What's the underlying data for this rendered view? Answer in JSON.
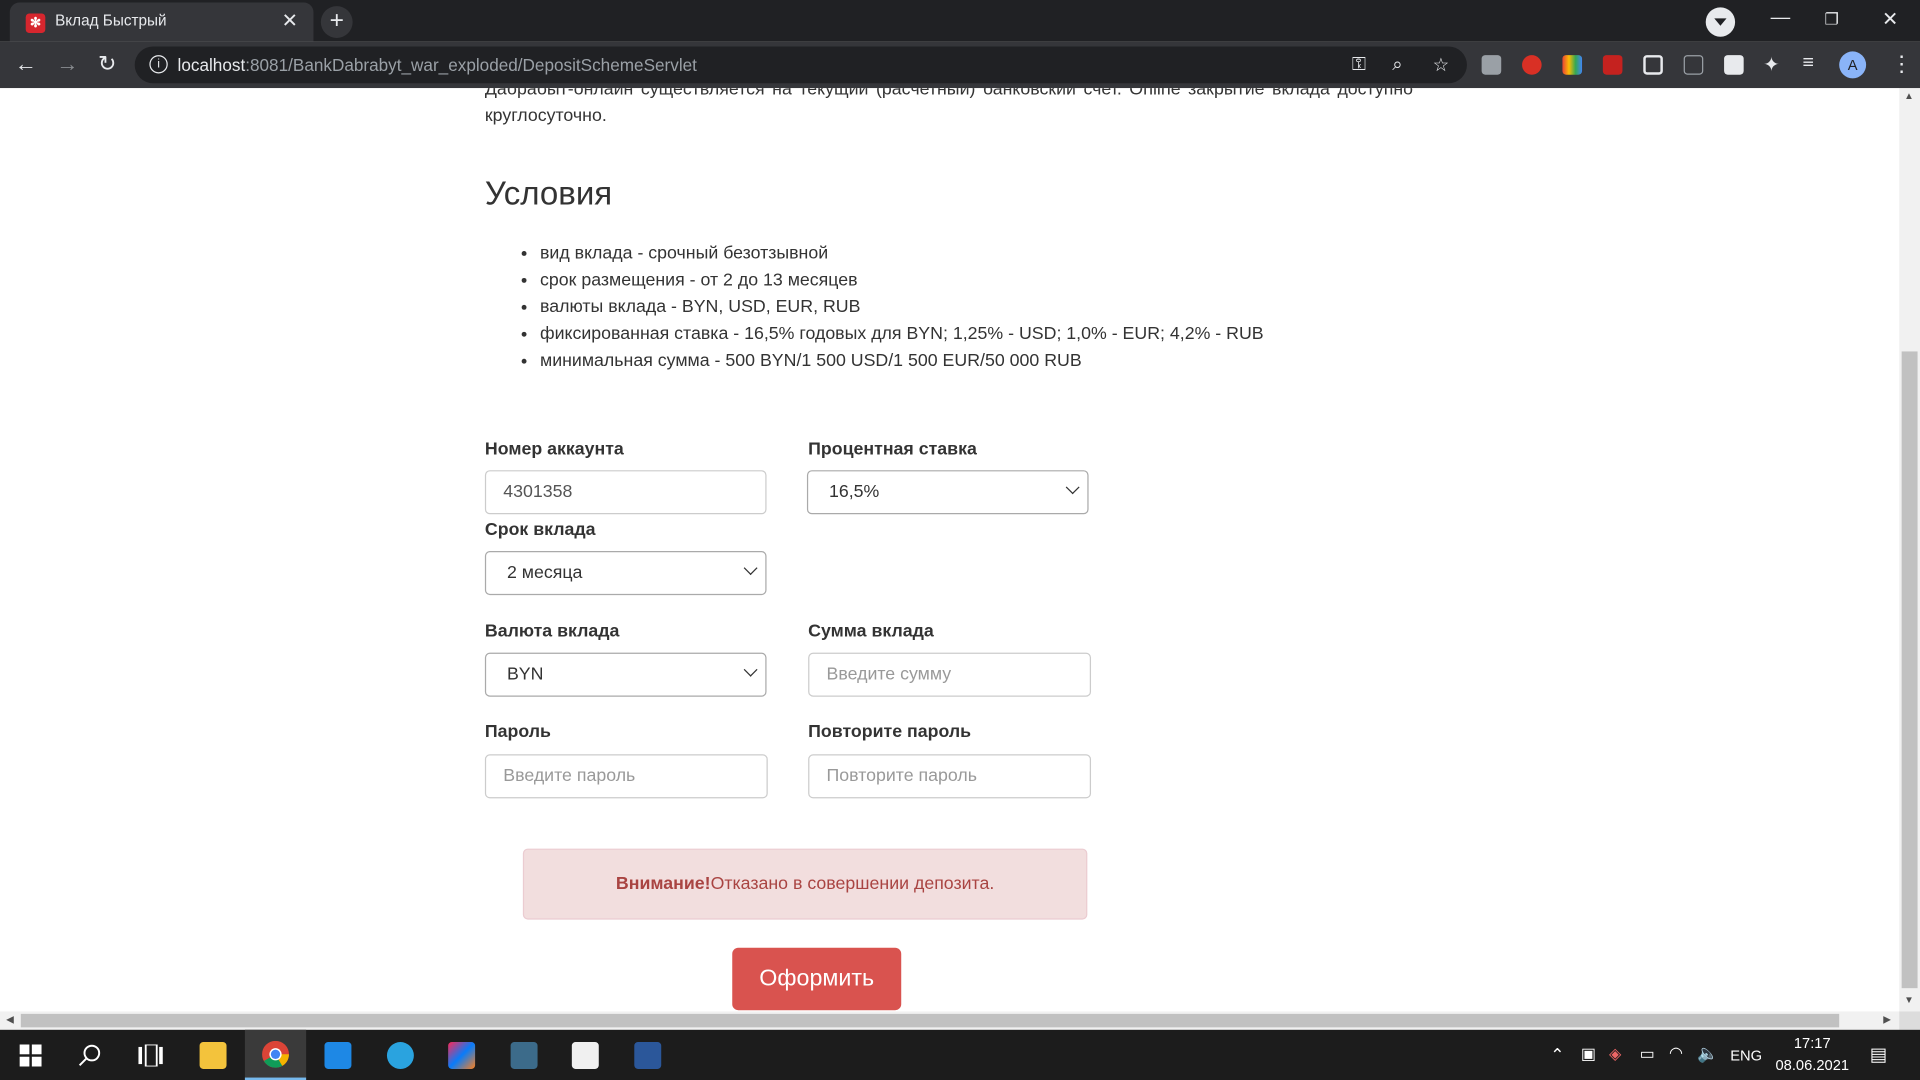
{
  "browser": {
    "tab_title": "Вклад Быстрый",
    "tab_favicon_letter": "✻",
    "url_host": "localhost",
    "url_rest": ":8081/BankDabrabyt_war_exploded/DepositSchemeServlet",
    "profile_initial": "A"
  },
  "page": {
    "intro_text": "Дабрабыт-онлайн существляется на текущий (расчетный) банковский счет. Online закрытие вклада доступно круглосуточно.",
    "conditions_heading": "Условия",
    "conditions": [
      "вид вклада - срочный безотзывной",
      "срок размещения - от 2 до 13 месяцев",
      "валюты вклада - BYN, USD, EUR, RUB",
      "фиксированная ставка - 16,5% годовых для BYN; 1,25% - USD; 1,0% - EUR; 4,2% - RUB",
      "минимальная сумма - 500 BYN/1 500 USD/1 500 EUR/50 000 RUB"
    ],
    "form": {
      "account_label": "Номер аккаунта",
      "account_value": "4301358",
      "rate_label": "Процентная ставка",
      "rate_value": "16,5%",
      "term_label": "Срок вклада",
      "term_value": "2 месяца",
      "currency_label": "Валюта вклада",
      "currency_value": "BYN",
      "amount_label": "Сумма вклада",
      "amount_placeholder": "Введите сумму",
      "password_label": "Пароль",
      "password_placeholder": "Введите пароль",
      "repeat_label": "Повторите пароль",
      "repeat_placeholder": "Повторите пароль"
    },
    "alert": {
      "strong": "Внимание!",
      "text": "Отказано в совершении депозита."
    },
    "submit_label": "Оформить"
  },
  "taskbar": {
    "language": "ENG",
    "time": "17:17",
    "date": "08.06.2021"
  },
  "colors": {
    "alert_bg": "#f2dede",
    "alert_text": "#a94442",
    "button_bg": "#d9534f"
  }
}
